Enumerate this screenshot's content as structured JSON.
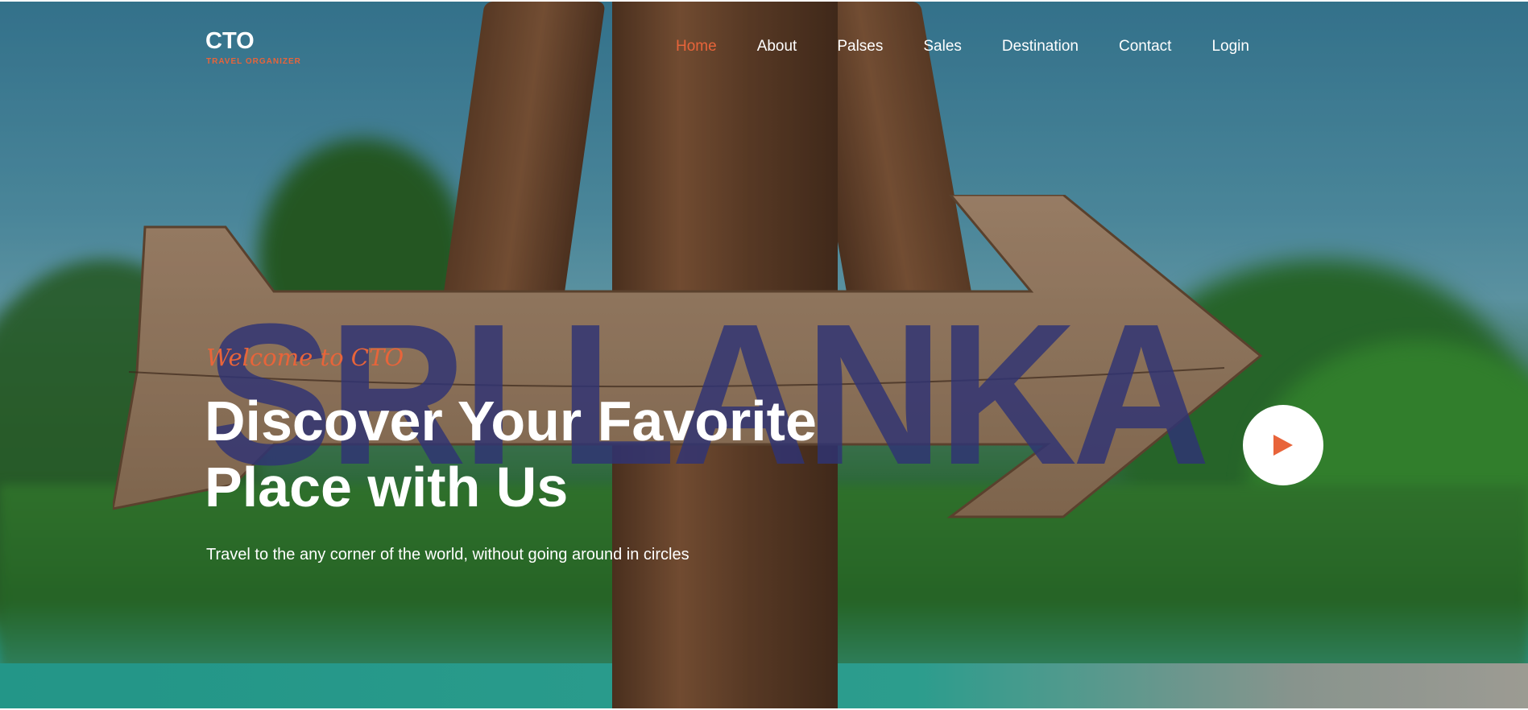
{
  "brand": {
    "title": "CTO",
    "subtitle": "TRAVEL ORGANIZER"
  },
  "nav": {
    "items": [
      {
        "label": "Home",
        "active": true
      },
      {
        "label": "About",
        "active": false
      },
      {
        "label": "Palses",
        "active": false
      },
      {
        "label": "Sales",
        "active": false
      },
      {
        "label": "Destination",
        "active": false
      },
      {
        "label": "Contact",
        "active": false
      },
      {
        "label": "Login",
        "active": false
      }
    ]
  },
  "hero": {
    "welcome": "Welcome to CTO",
    "headline_line1": "Discover Your Favorite",
    "headline_line2": "Place with Us",
    "subtext": "Travel to the any corner of the world, without going around in circles",
    "sign_text": "SRI LANKA",
    "play_icon": "play-icon"
  },
  "colors": {
    "accent": "#e8643a",
    "text": "#ffffff",
    "sign_ink": "#3a3f8f"
  }
}
